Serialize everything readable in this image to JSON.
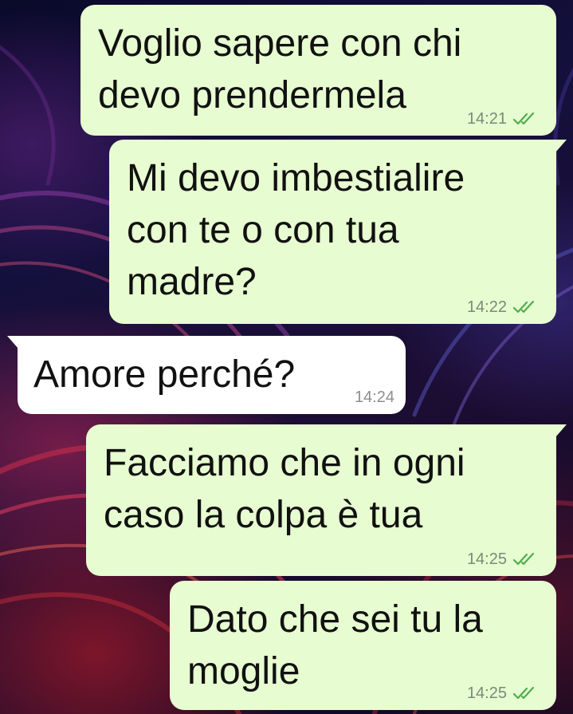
{
  "chat": {
    "messages": [
      {
        "direction": "outgoing",
        "text": "Voglio sapere con chi\ndevo prendermela",
        "time": "14:21",
        "status": "read"
      },
      {
        "direction": "outgoing",
        "text": "Mi devo imbestialire\ncon te o con tua\nmadre?",
        "time": "14:22",
        "status": "read"
      },
      {
        "direction": "incoming",
        "text": "Amore perché?",
        "time": "14:24"
      },
      {
        "direction": "outgoing",
        "text": "Facciamo che in ogni\ncaso la colpa è tua",
        "time": "14:25",
        "status": "read"
      },
      {
        "direction": "outgoing",
        "text": "Dato che sei tu la\nmoglie",
        "time": "14:25",
        "status": "read"
      }
    ]
  },
  "colors": {
    "outgoing_bubble": "#e7fcd0",
    "incoming_bubble": "#ffffff",
    "read_ticks": "#4fae4e"
  },
  "icons": {
    "read_status": "double-check-icon"
  }
}
